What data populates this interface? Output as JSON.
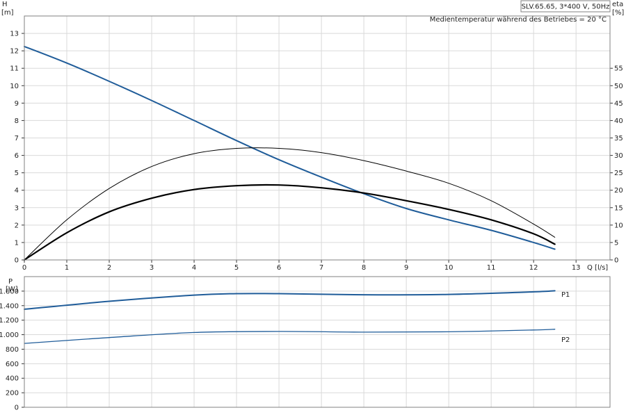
{
  "chart_data": [
    {
      "type": "line",
      "title": "SLV.65.65, 3*400 V, 50Hz",
      "subtitle": "Medientemperatur während des Betriebes = 20 °C",
      "x_axis": {
        "label": "Q [l/s]",
        "range": [
          0,
          13.8
        ],
        "ticks": [
          0,
          1,
          2,
          3,
          4,
          5,
          6,
          7,
          8,
          9,
          10,
          11,
          12,
          13
        ]
      },
      "y_left": {
        "label_top": "H",
        "label_unit": "[m]",
        "range": [
          0,
          14
        ],
        "ticks": [
          0,
          1,
          2,
          3,
          4,
          5,
          6,
          7,
          8,
          9,
          10,
          11,
          12,
          13
        ]
      },
      "y_right": {
        "label_top": "eta",
        "label_unit": "[%]",
        "range": [
          0,
          70
        ],
        "ticks": [
          0,
          5,
          10,
          15,
          20,
          25,
          30,
          35,
          40,
          45,
          50,
          55
        ]
      },
      "grid": true,
      "series": [
        {
          "key": "H",
          "axis": "left",
          "color": "#1f5c99",
          "x": [
            0,
            1,
            2,
            3,
            4,
            5,
            6,
            7,
            8,
            9,
            10,
            11,
            12,
            12.5
          ],
          "y": [
            12.25,
            11.3,
            10.25,
            9.15,
            8.0,
            6.85,
            5.75,
            4.75,
            3.8,
            2.95,
            2.3,
            1.7,
            1.0,
            0.62
          ]
        },
        {
          "key": "eta_thin",
          "axis": "right",
          "color": "#000000",
          "width": 1,
          "x": [
            0,
            1,
            2,
            3,
            4,
            5,
            6,
            7,
            8,
            9,
            10,
            11,
            12,
            12.5
          ],
          "y": [
            0,
            11.5,
            20.5,
            26.8,
            30.5,
            32.0,
            32.0,
            30.8,
            28.5,
            25.5,
            22.0,
            17.0,
            10.3,
            6.5
          ]
        },
        {
          "key": "eta_thick",
          "axis": "right",
          "color": "#000000",
          "width": 2.2,
          "x": [
            0,
            1,
            2,
            3,
            4,
            5,
            6,
            7,
            8,
            9,
            10,
            11,
            12,
            12.5
          ],
          "y": [
            0,
            7.8,
            13.8,
            17.7,
            20.2,
            21.3,
            21.5,
            20.7,
            19.2,
            17.0,
            14.5,
            11.5,
            7.5,
            4.5
          ]
        }
      ]
    },
    {
      "type": "line",
      "x_axis": {
        "range": [
          0,
          13.8
        ]
      },
      "y_left": {
        "label_top": "P",
        "label_unit": "[W]",
        "range": [
          0,
          1800
        ],
        "ticks": [
          0,
          200,
          400,
          600,
          800,
          1000,
          1200,
          1400,
          1600
        ],
        "tick_labels": [
          "0",
          "200",
          "400",
          "600",
          "800",
          "1.000",
          "1.200",
          "1.400",
          "1.600"
        ]
      },
      "grid": true,
      "series": [
        {
          "name": "P1",
          "color": "#1f5c99",
          "width": 2,
          "x": [
            0,
            2,
            4,
            5,
            6,
            8,
            10,
            12,
            12.5
          ],
          "y": [
            1350,
            1460,
            1545,
            1565,
            1565,
            1550,
            1555,
            1590,
            1605
          ]
        },
        {
          "name": "P2",
          "color": "#1f5c99",
          "width": 1.3,
          "x": [
            0,
            2,
            4,
            6,
            8,
            10,
            12,
            12.5
          ],
          "y": [
            880,
            960,
            1030,
            1045,
            1035,
            1040,
            1065,
            1075
          ]
        }
      ]
    }
  ]
}
